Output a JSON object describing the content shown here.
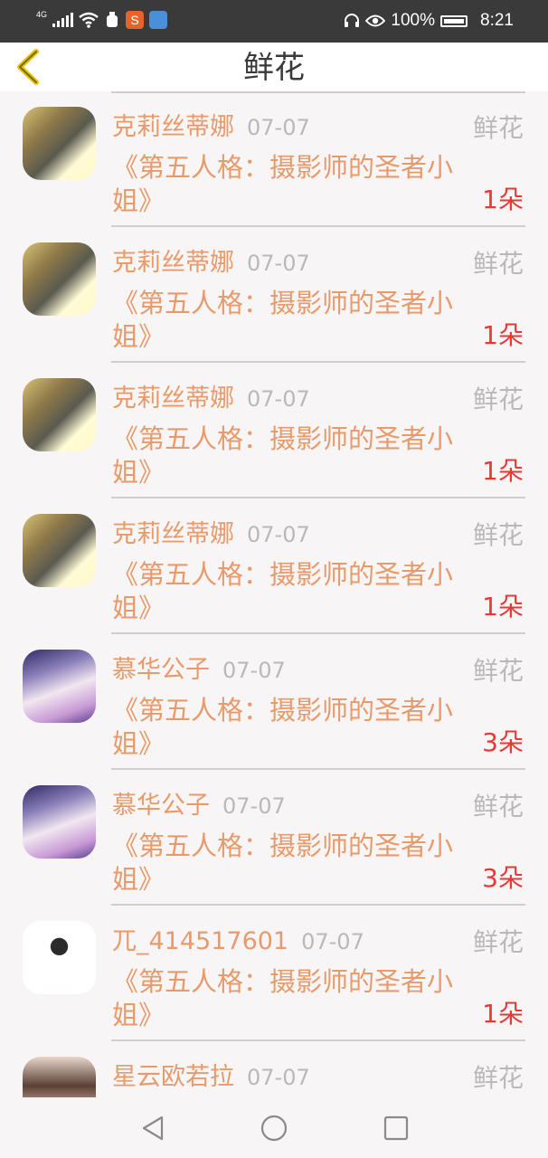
{
  "status_bar": {
    "network": "4G",
    "battery": "100%",
    "time": "8:21",
    "icons": [
      "signal-icon",
      "wifi-icon",
      "usb-icon",
      "app-s-icon",
      "app-browser-icon",
      "headphone-icon",
      "eye-icon",
      "battery-icon"
    ]
  },
  "header": {
    "title": "鲜花",
    "back_icon": "back-chevron-icon"
  },
  "colors": {
    "accent": "#e89a6a",
    "count": "#e63a36",
    "muted": "#b9b9b9",
    "back": "#e8c200"
  },
  "records": [
    {
      "user": "克莉丝蒂娜",
      "date": "07-07",
      "kind": "鲜花",
      "book": "《第五人格：摄影师的圣者小姐》",
      "count": "1朵",
      "avatar": "a"
    },
    {
      "user": "克莉丝蒂娜",
      "date": "07-07",
      "kind": "鲜花",
      "book": "《第五人格：摄影师的圣者小姐》",
      "count": "1朵",
      "avatar": "a"
    },
    {
      "user": "克莉丝蒂娜",
      "date": "07-07",
      "kind": "鲜花",
      "book": "《第五人格：摄影师的圣者小姐》",
      "count": "1朵",
      "avatar": "a"
    },
    {
      "user": "克莉丝蒂娜",
      "date": "07-07",
      "kind": "鲜花",
      "book": "《第五人格：摄影师的圣者小姐》",
      "count": "1朵",
      "avatar": "a"
    },
    {
      "user": "慕华公子",
      "date": "07-07",
      "kind": "鲜花",
      "book": "《第五人格：摄影师的圣者小姐》",
      "count": "3朵",
      "avatar": "b"
    },
    {
      "user": "慕华公子",
      "date": "07-07",
      "kind": "鲜花",
      "book": "《第五人格：摄影师的圣者小姐》",
      "count": "3朵",
      "avatar": "b"
    },
    {
      "user": "兀_414517601",
      "date": "07-07",
      "kind": "鲜花",
      "book": "《第五人格：摄影师的圣者小姐》",
      "count": "1朵",
      "avatar": "c"
    },
    {
      "user": "星云欧若拉",
      "date": "07-07",
      "kind": "鲜花",
      "book": "",
      "count": "",
      "avatar": "d"
    }
  ],
  "nav": {
    "back_icon": "nav-back-triangle-icon",
    "home_icon": "nav-home-circle-icon",
    "recent_icon": "nav-recent-square-icon"
  }
}
